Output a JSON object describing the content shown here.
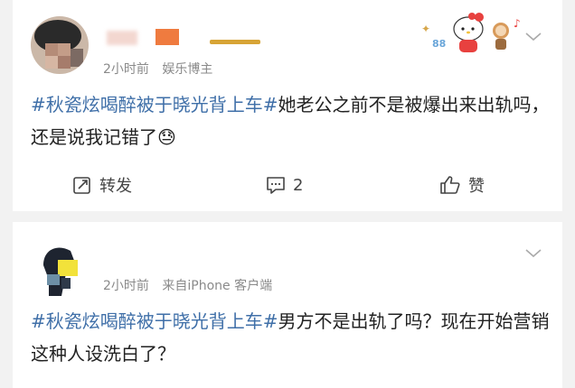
{
  "post1": {
    "time": "2小时前",
    "source": "娱乐博主",
    "topic": "#秋瓷炫喝醉被于晓光背上车#",
    "text": "她老公之前不是被爆出来出轨吗，还是说我记错了",
    "emoji": "😓",
    "actions": {
      "repost": "转发",
      "comment_count": "2",
      "like": "赞"
    }
  },
  "post2": {
    "time": "2小时前",
    "source": "来自iPhone 客户端",
    "topic": "#秋瓷炫喝醉被于晓光背上车#",
    "text": "男方不是出轨了吗？现在开始营销这种人设洗白了？"
  },
  "colors": {
    "topic": "#3f6fa8",
    "meta": "#8a8a8a",
    "background": "#f2f2f2"
  },
  "icons": [
    "blurred-avatar",
    "hello-kitty-sticker",
    "chevron-down-icon",
    "repost-icon",
    "comment-icon",
    "thumbs-up-icon"
  ]
}
